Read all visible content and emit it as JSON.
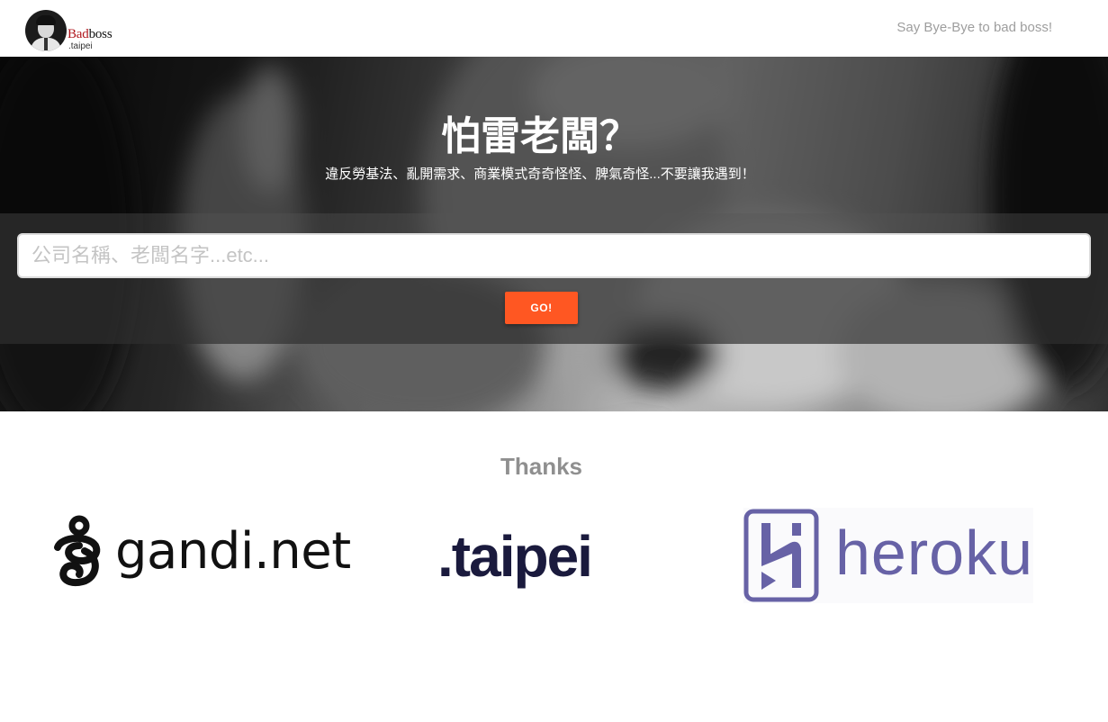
{
  "header": {
    "logo_brand_red": "Bad",
    "logo_brand_dark": "boss",
    "logo_sub": ".taipei",
    "tagline": "Say Bye-Bye to bad boss!"
  },
  "hero": {
    "title": "怕雷老闆？",
    "subtitle": "違反勞基法、亂開需求、商業模式奇奇怪怪、脾氣奇怪...不要讓我遇到！",
    "search_placeholder": "公司名稱、老闆名字...etc...",
    "search_value": "",
    "go_label": "GO!"
  },
  "thanks": {
    "title": "Thanks",
    "sponsors": [
      {
        "name": "gandi.net",
        "icon": "gandi-logo-icon"
      },
      {
        "name": ".taipei",
        "icon": "taipei-wordmark"
      },
      {
        "name": "heroku",
        "icon": "heroku-logo-icon"
      }
    ]
  },
  "colors": {
    "accent": "#ff5722",
    "brand_red": "#b0161c",
    "heroku_purple": "#6762a6",
    "taipei_navy": "#1a1a3d",
    "taipei_purple_dot": "#7a52c2",
    "muted_text": "#9e9e9e"
  }
}
